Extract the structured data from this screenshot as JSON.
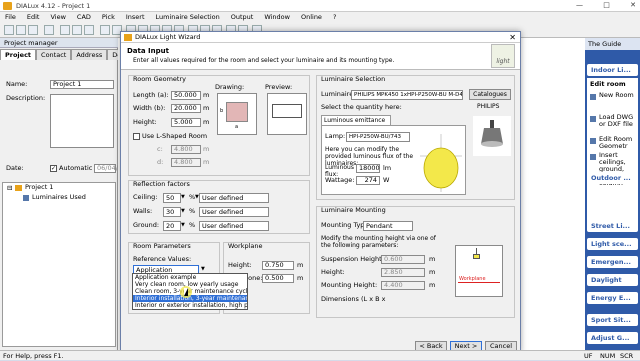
{
  "app": {
    "title": "DIALux 4.12 - Project 1"
  },
  "menu": [
    "File",
    "Edit",
    "View",
    "CAD",
    "Pick",
    "Insert",
    "Luminaire Selection",
    "Output",
    "Window",
    "Online",
    "?"
  ],
  "project_manager": {
    "header": "Project manager",
    "tabs": [
      "Project",
      "Contact",
      "Address",
      "Detail"
    ],
    "name_label": "Name:",
    "name_value": "Project 1",
    "description_label": "Description:",
    "date_label": "Date:",
    "automatic_label": "Automatic",
    "date_value": "06/04/2",
    "tree": [
      "Project 1",
      "Luminaires Used"
    ]
  },
  "dialog": {
    "title": "DIALux Light Wizard",
    "heading": "Data Input",
    "subheading": "Enter all values required for the room and select your luminaire and its mounting type.",
    "logo": "light",
    "room_geometry": {
      "title": "Room Geometry",
      "length_label": "Length (a):",
      "length_value": "50.000",
      "width_label": "Width (b):",
      "width_value": "20.000",
      "height_label": "Height:",
      "height_value": "5.000",
      "unit": "m",
      "lshape_label": "Use L-Shaped Room",
      "c_label": "c:",
      "c_value": "4.800",
      "d_label": "d:",
      "d_value": "4.800",
      "drawing_label": "Drawing:",
      "preview_label": "Preview:",
      "drawing_b": "b",
      "drawing_a": "a"
    },
    "reflection": {
      "title": "Reflection factors",
      "rows": [
        {
          "label": "Ceiling:",
          "value": "50",
          "unit": "%",
          "type": "User defined"
        },
        {
          "label": "Walls:",
          "value": "30",
          "unit": "%",
          "type": "User defined"
        },
        {
          "label": "Ground:",
          "value": "20",
          "unit": "%",
          "type": "User defined"
        }
      ]
    },
    "room_params": {
      "title": "Room Parameters",
      "ref_values_label": "Reference Values:",
      "selected": "Application example",
      "options": [
        "Application example",
        "Very clean room, low yearly usage",
        "Clean room, 3-year maintenance cycle",
        "Interior installation, 3-year maintenance cycle",
        "Interior or exterior installation, high pollution"
      ],
      "highlighted_index": 3
    },
    "workplane": {
      "title": "Workplane",
      "height_label": "Height:",
      "height_value": "0.750",
      "edge_label": "Wall Zone:",
      "edge_value": "0.500",
      "unit": "m"
    },
    "luminaire": {
      "title": "Luminaire Selection",
      "luminaire_label": "Luminaire:",
      "luminaire_value": "PHILIPS MPK450 1xHPI-P250W-BU M-D45",
      "catalogues_btn": "Catalogues",
      "quantity_label": "Select the quantity here:",
      "brand": "PHILIPS",
      "tab": "Luminous emittance 1",
      "lamp_label": "Lamp:",
      "lamp_value": "HPI-P250W-BU/743",
      "modify_text": "Here you can modify the provided luminous flux of the luminaires:",
      "flux_label": "Luminous flux:",
      "flux_value": "18000",
      "flux_unit": "lm",
      "wattage_label": "Wattage:",
      "wattage_value": "274",
      "wattage_unit": "W"
    },
    "mounting": {
      "title": "Luminaire Mounting",
      "type_label": "Mounting Type:",
      "type_value": "Pendant",
      "modify_text": "Modify the mounting height via one of the following parameters:",
      "suspension_label": "Suspension Height:",
      "suspension_value": "0.600",
      "height_label": "Height:",
      "height_value": "2.850",
      "mounting_label": "Mounting Height:",
      "mounting_value": "4.400",
      "unit": "m",
      "dimensions_label": "Dimensions (L x B x",
      "workplane_label": "Workplane"
    },
    "buttons": {
      "back": "< Back",
      "next": "Next >",
      "cancel": "Cancel"
    }
  },
  "guide": {
    "header": "The Guide",
    "indoor": "Indoor Li...",
    "edit_room": "Edit room",
    "items": [
      "New Room",
      "Load DWG or DXF file",
      "Edit Room Geometr",
      "Insert ceilings, ground, and column"
    ],
    "panels": [
      "Outdoor ...",
      "Street Li...",
      "Light sce...",
      "Emergen...",
      "Daylight",
      "Energy E...",
      "Sport Sit...",
      "Adjust G..."
    ]
  },
  "status": {
    "text": "For Help, press F1.",
    "right": [
      "UF",
      "NUM",
      "SCR"
    ]
  },
  "colors": {
    "accent": "#2f6fd6",
    "guide_bg": "#2f5aa8",
    "lamp_yellow": "#f3e84a",
    "room_pink": "#e2b6b6"
  }
}
